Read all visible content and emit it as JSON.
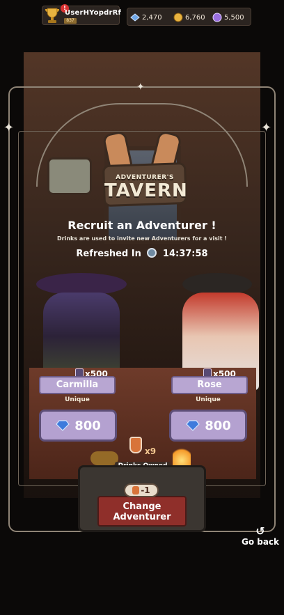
{
  "profile": {
    "username": "UserHYopdrRf",
    "trophies": "837",
    "notification": "!"
  },
  "currencies": [
    {
      "name": "crystals",
      "value": "2,470",
      "color": "#6fa7e8"
    },
    {
      "name": "gold",
      "value": "6,760",
      "color": "#e8b340"
    },
    {
      "name": "gems",
      "value": "5,500",
      "color": "#9a6fe0"
    }
  ],
  "tavern": {
    "sign_top": "ADVENTURER'S",
    "sign_bottom": "TAVERN",
    "title": "Recruit an Adventurer !",
    "subtitle": "Drinks are used to invite new Adventurers for a visit !",
    "refreshed_label": "Refreshed In",
    "refresh_timer": "14:37:58"
  },
  "adventurers": [
    {
      "name": "Carmilla",
      "count": "x500",
      "rarity": "Unique",
      "price": "800"
    },
    {
      "name": "Rose",
      "count": "x500",
      "rarity": "Unique",
      "price": "800"
    }
  ],
  "drinks": {
    "count": "x9",
    "label": "Drinks Owned"
  },
  "change": {
    "cost": "-1",
    "label_line1": "Change",
    "label_line2": "Adventurer"
  },
  "nav": {
    "go_back": "Go back"
  },
  "colors": {
    "accent_purple": "#b4a1d0",
    "button_red": "#8f2f2a",
    "frame": "#8f8476"
  }
}
